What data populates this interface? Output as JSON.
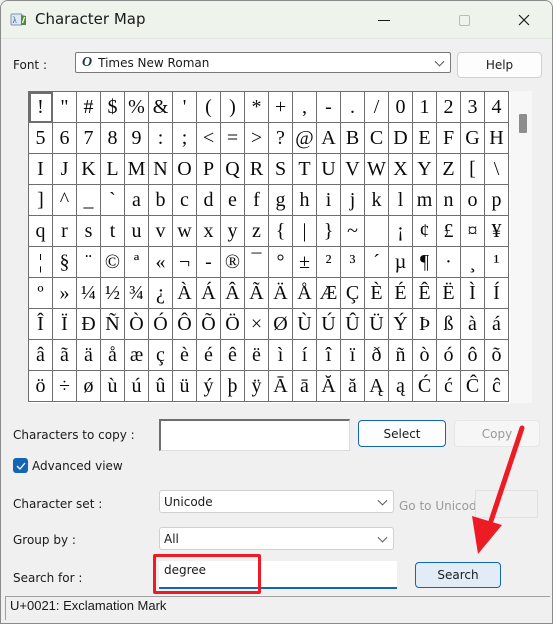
{
  "window": {
    "title": "Character Map",
    "app_icon": "character-map-icon",
    "controls": {
      "minimize": "minimize-icon",
      "maximize": "maximize-icon",
      "close": "close-icon"
    }
  },
  "font": {
    "label": "Font :",
    "selected": "Times New Roman",
    "font_type_glyph": "O",
    "font_type_icon": "opentype-font-icon"
  },
  "help_button": "Help",
  "grid": {
    "selected_index": 0,
    "rows": [
      [
        "!",
        "\"",
        "#",
        "$",
        "%",
        "&",
        "'",
        "(",
        ")",
        "*",
        "+",
        ",",
        "-",
        ".",
        "/",
        "0",
        "1",
        "2",
        "3",
        "4"
      ],
      [
        "5",
        "6",
        "7",
        "8",
        "9",
        ":",
        ";",
        "<",
        "=",
        ">",
        "?",
        "@",
        "A",
        "B",
        "C",
        "D",
        "E",
        "F",
        "G",
        "H"
      ],
      [
        "I",
        "J",
        "K",
        "L",
        "M",
        "N",
        "O",
        "P",
        "Q",
        "R",
        "S",
        "T",
        "U",
        "V",
        "W",
        "X",
        "Y",
        "Z",
        "[",
        "\\"
      ],
      [
        "]",
        "^",
        "_",
        "`",
        "a",
        "b",
        "c",
        "d",
        "e",
        "f",
        "g",
        "h",
        "i",
        "j",
        "k",
        "l",
        "m",
        "n",
        "o",
        "p"
      ],
      [
        "q",
        "r",
        "s",
        "t",
        "u",
        "v",
        "w",
        "x",
        "y",
        "z",
        "{",
        "|",
        "}",
        "~",
        " ",
        "¡",
        "¢",
        "£",
        "¤",
        "¥"
      ],
      [
        "¦",
        "§",
        "¨",
        "©",
        "ª",
        "«",
        "¬",
        "-",
        "®",
        "¯",
        "°",
        "±",
        "²",
        "³",
        "´",
        "µ",
        "¶",
        "·",
        "¸",
        "¹"
      ],
      [
        "º",
        "»",
        "¼",
        "½",
        "¾",
        "¿",
        "À",
        "Á",
        "Â",
        "Ã",
        "Ä",
        "Å",
        "Æ",
        "Ç",
        "È",
        "É",
        "Ê",
        "Ë",
        "Ì",
        "Í"
      ],
      [
        "Î",
        "Ï",
        "Ð",
        "Ñ",
        "Ò",
        "Ó",
        "Ô",
        "Õ",
        "Ö",
        "×",
        "Ø",
        "Ù",
        "Ú",
        "Û",
        "Ü",
        "Ý",
        "Þ",
        "ß",
        "à",
        "á"
      ],
      [
        "â",
        "ã",
        "ä",
        "å",
        "æ",
        "ç",
        "è",
        "é",
        "ê",
        "ë",
        "ì",
        "í",
        "î",
        "ï",
        "ð",
        "ñ",
        "ò",
        "ó",
        "ô",
        "õ"
      ],
      [
        "ö",
        "÷",
        "ø",
        "ù",
        "ú",
        "û",
        "ü",
        "ý",
        "þ",
        "ÿ",
        "Ā",
        "ā",
        "Ă",
        "ă",
        "Ą",
        "ą",
        "Ć",
        "ć",
        "Ĉ",
        "ĉ"
      ]
    ],
    "scroll_position": 0.0
  },
  "copy": {
    "label": "Characters to copy :",
    "value": "",
    "select_button": "Select",
    "copy_button": "Copy"
  },
  "advanced_view": {
    "label": "Advanced view",
    "checked": true
  },
  "character_set": {
    "label": "Character set :",
    "selected": "Unicode"
  },
  "goto_unicode": {
    "label": "Go to Unicode :",
    "value": ""
  },
  "group_by": {
    "label": "Group by :",
    "selected": "All"
  },
  "search": {
    "label": "Search for :",
    "value": "degree",
    "button": "Search"
  },
  "status": "U+0021: Exclamation Mark",
  "annotation": {
    "color": "#ed1c24"
  },
  "colors": {
    "accent": "#1366b4",
    "titlebar": "#eef4ec"
  }
}
